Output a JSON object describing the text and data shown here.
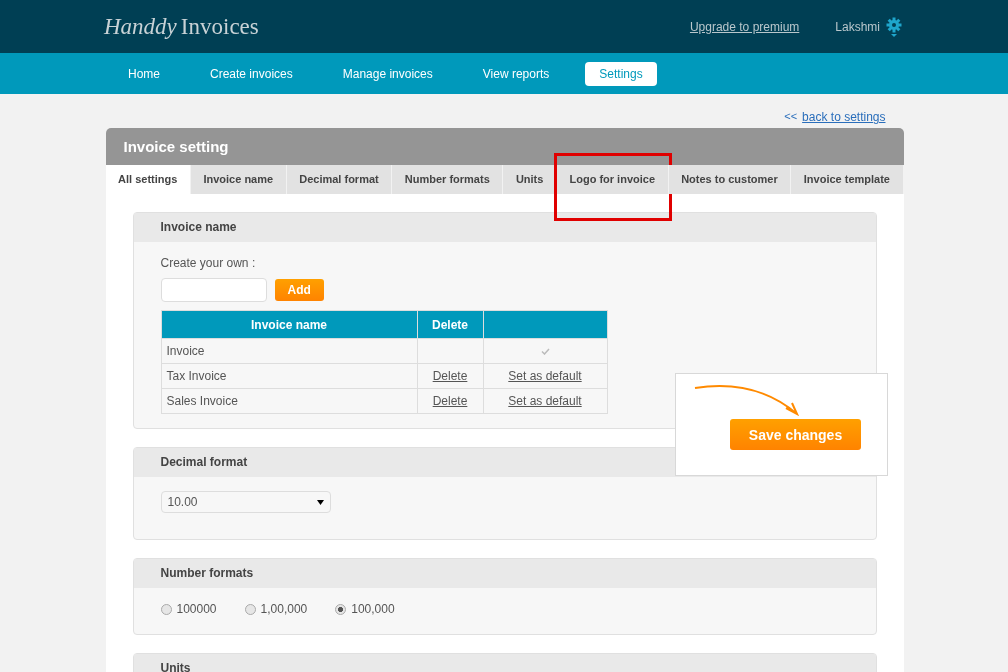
{
  "header": {
    "logo_script": "Handdy",
    "logo_text": "Invoices",
    "upgrade_link": "Upgrade to premium",
    "user": "Lakshmi"
  },
  "nav": [
    {
      "label": "Home",
      "selected": false
    },
    {
      "label": "Create invoices",
      "selected": false
    },
    {
      "label": "Manage invoices",
      "selected": false
    },
    {
      "label": "View reports",
      "selected": false
    },
    {
      "label": "Settings",
      "selected": true
    }
  ],
  "back_link": {
    "arrows": "<<",
    "label": "back to settings"
  },
  "panel_title": "Invoice setting",
  "tabs": [
    {
      "label": "All settings",
      "selected": true,
      "highlighted": false
    },
    {
      "label": "Invoice name",
      "selected": false,
      "highlighted": false
    },
    {
      "label": "Decimal format",
      "selected": false,
      "highlighted": false
    },
    {
      "label": "Number formats",
      "selected": false,
      "highlighted": false
    },
    {
      "label": "Units",
      "selected": false,
      "highlighted": false
    },
    {
      "label": "Logo for invoice",
      "selected": false,
      "highlighted": true
    },
    {
      "label": "Notes to customer",
      "selected": false,
      "highlighted": false
    },
    {
      "label": "Invoice template",
      "selected": false,
      "highlighted": false
    }
  ],
  "invoice_name": {
    "title": "Invoice name",
    "create_label": "Create your own :",
    "add_button": "Add",
    "columns": [
      "Invoice name",
      "Delete"
    ],
    "rows": [
      {
        "name": "Invoice",
        "default": true
      },
      {
        "name": "Tax Invoice",
        "delete": "Delete",
        "default": false,
        "set_default": "Set as default"
      },
      {
        "name": "Sales Invoice",
        "delete": "Delete",
        "default": false,
        "set_default": "Set as default"
      }
    ]
  },
  "decimal_format": {
    "title": "Decimal format",
    "value": "10.00"
  },
  "number_formats": {
    "title": "Number formats",
    "options": [
      {
        "label": "100000",
        "selected": false
      },
      {
        "label": "1,00,000",
        "selected": false
      },
      {
        "label": "100,000",
        "selected": true
      }
    ]
  },
  "units": {
    "title": "Units"
  },
  "save_button": "Save changes"
}
